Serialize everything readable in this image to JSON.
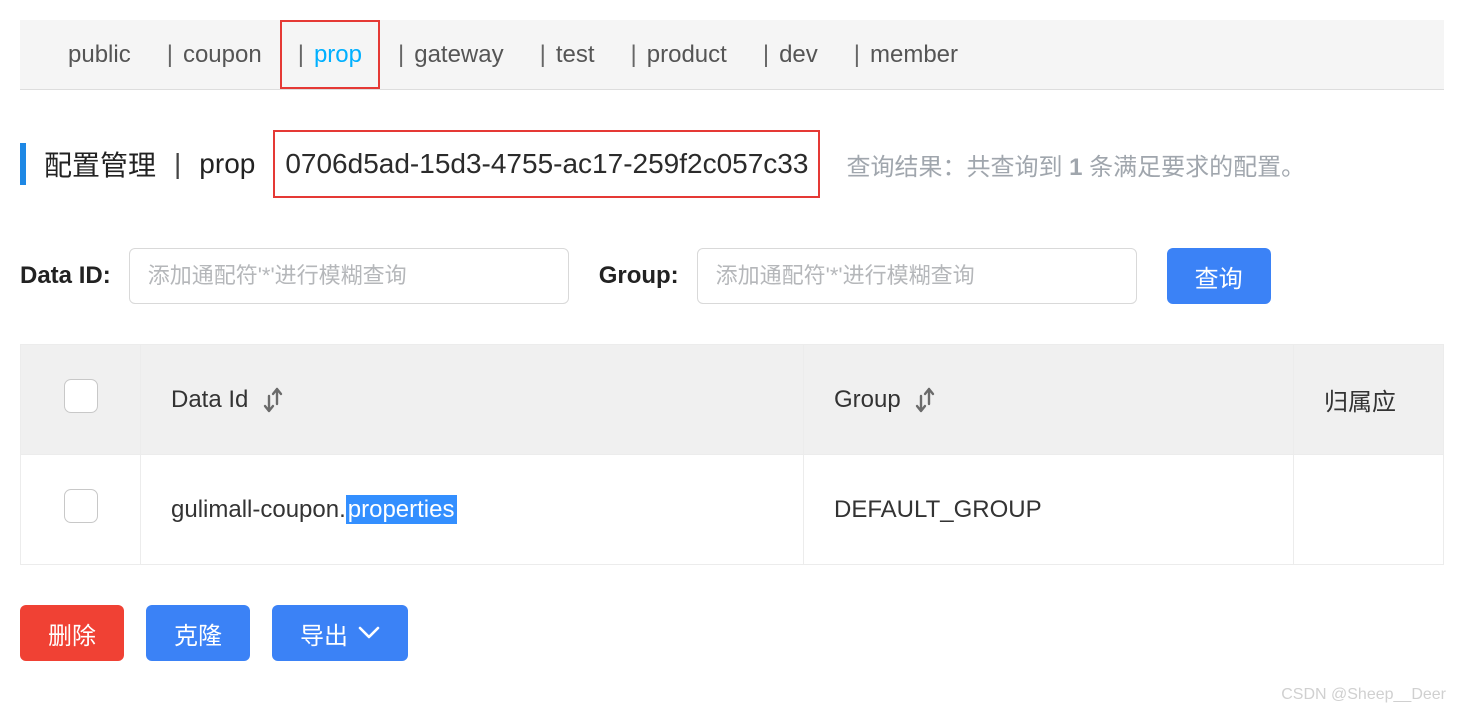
{
  "tabs": [
    {
      "label": "public"
    },
    {
      "label": "coupon"
    },
    {
      "label": "prop",
      "active": true
    },
    {
      "label": "gateway"
    },
    {
      "label": "test"
    },
    {
      "label": "product"
    },
    {
      "label": "dev"
    },
    {
      "label": "member"
    }
  ],
  "breadcrumb": {
    "title": "配置管理",
    "scope": "prop",
    "uuid": "0706d5ad-15d3-4755-ac17-259f2c057c33"
  },
  "query_result": {
    "prefix": "查询结果：共查询到 ",
    "count": "1",
    "suffix": " 条满足要求的配置。"
  },
  "search": {
    "data_id_label": "Data ID:",
    "data_id_placeholder": "添加通配符'*'进行模糊查询",
    "group_label": "Group:",
    "group_placeholder": "添加通配符'*'进行模糊查询",
    "query_button": "查询"
  },
  "table": {
    "headers": {
      "data_id": "Data Id",
      "group": "Group",
      "app": "归属应"
    },
    "rows": [
      {
        "data_id_prefix": "gulimall-coupon.",
        "data_id_highlight": "properties",
        "group": "DEFAULT_GROUP",
        "app": ""
      }
    ]
  },
  "actions": {
    "delete": "删除",
    "clone": "克隆",
    "export": "导出"
  },
  "watermark": "CSDN @Sheep__Deer"
}
